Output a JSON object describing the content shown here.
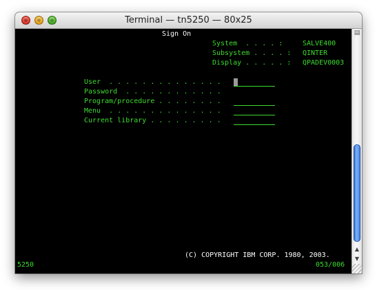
{
  "window": {
    "title": "Terminal — tn5250 — 80x25"
  },
  "screen": {
    "header": "Sign On",
    "system": {
      "label": "System  . . . . :",
      "value": "SALVE400"
    },
    "subsystem": {
      "label": "Subsystem . . . . :",
      "value": "QINTER"
    },
    "display": {
      "label": "Display . . . . . :",
      "value": "QPADEV0003"
    },
    "fields": [
      {
        "label": "User  . . . . . . . . . . . . . ."
      },
      {
        "label": "Password  . . . . . . . . . . . ."
      },
      {
        "label": "Program/procedure . . . . . . . ."
      },
      {
        "label": "Menu  . . . . . . . . . . . . . ."
      },
      {
        "label": "Current library . . . . . . . . ."
      }
    ],
    "copyright": "(C) COPYRIGHT IBM CORP. 1980, 2003."
  },
  "status": {
    "terminal_type": "5250",
    "cursor_position": "053/006"
  },
  "scrollbar": {
    "position_fraction": 0.62
  },
  "colors": {
    "terminal_text": "#3ddc2f",
    "terminal_background": "#000000",
    "header_text": "#ffffff"
  }
}
